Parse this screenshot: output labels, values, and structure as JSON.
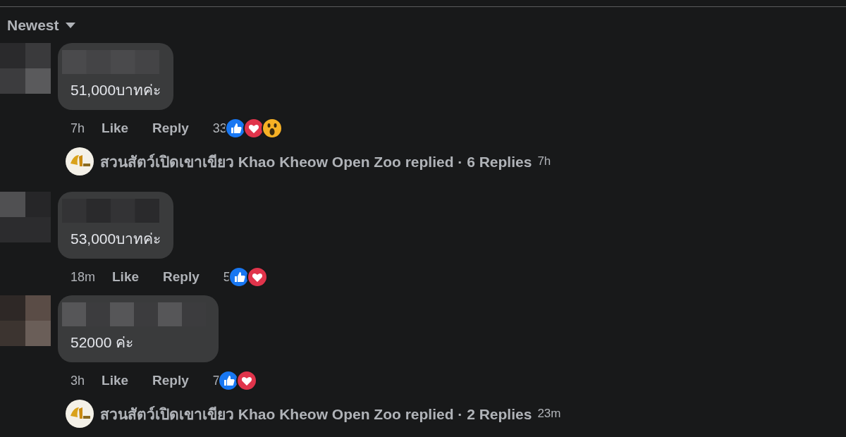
{
  "sort": {
    "label": "Newest"
  },
  "comments": [
    {
      "text": "51,000บาทค่ะ",
      "time": "7h",
      "actions": [
        "Like",
        "Reply"
      ],
      "count": "33",
      "reactions": [
        {
          "kind": "like"
        },
        {
          "kind": "love"
        },
        {
          "kind": "wow"
        }
      ],
      "replies": {
        "text": "สวนสัตว์เปิดเขาเขียว Khao Kheow Open Zoo replied · 6 Replies",
        "time": "7h"
      }
    },
    {
      "text": "53,000บาทค่ะ",
      "time": "18m",
      "actions": [
        "Like",
        "Reply"
      ],
      "count": "5",
      "reactions": [
        {
          "kind": "like"
        },
        {
          "kind": "love"
        }
      ]
    },
    {
      "text": "52000 ค่ะ",
      "time": "3h",
      "actions": [
        "Like",
        "Reply"
      ],
      "count": "7",
      "reactions": [
        {
          "kind": "like"
        },
        {
          "kind": "love"
        }
      ],
      "replies": {
        "text": "สวนสัตว์เปิดเขาเขียว Khao Kheow Open Zoo replied · 2 Replies",
        "time": "23m"
      }
    }
  ]
}
